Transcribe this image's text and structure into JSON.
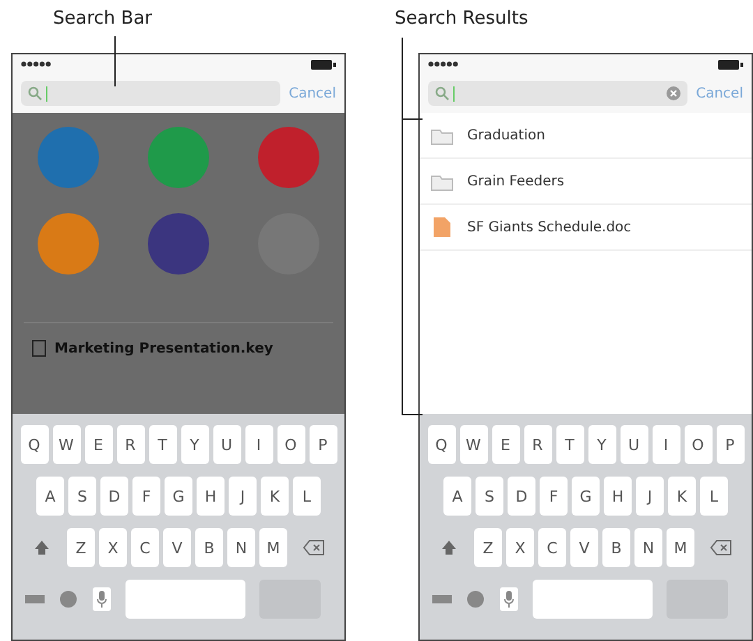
{
  "annotations": [
    {
      "label": "Search Bar"
    },
    {
      "label": "Search Results"
    }
  ],
  "screens": [
    {
      "kind": "browse",
      "search": {
        "cancel": "Cancel",
        "clear_button": false
      },
      "apps": [
        {
          "color": "#1f6fae"
        },
        {
          "color": "#1f9a4a"
        },
        {
          "color": "#c0202c"
        },
        {
          "color": "#d97a16"
        },
        {
          "color": "#3b357f"
        },
        {
          "color": "#777777"
        }
      ],
      "recent": {
        "name": "Marketing Presentation.key"
      },
      "keyboard": {
        "rows": [
          [
            "Q",
            "W",
            "E",
            "R",
            "T",
            "Y",
            "U",
            "I",
            "O",
            "P"
          ],
          [
            "A",
            "S",
            "D",
            "F",
            "G",
            "H",
            "J",
            "K",
            "L"
          ],
          [
            "Z",
            "X",
            "C",
            "V",
            "B",
            "N",
            "M"
          ]
        ]
      }
    },
    {
      "kind": "results",
      "search": {
        "cancel": "Cancel",
        "clear_button": true
      },
      "results": [
        {
          "kind": "folder",
          "name": "Graduation"
        },
        {
          "kind": "folder",
          "name": "Grain Feeders"
        },
        {
          "kind": "document",
          "name": "SF Giants Schedule.doc"
        }
      ],
      "keyboard": {
        "rows": [
          [
            "Q",
            "W",
            "E",
            "R",
            "T",
            "Y",
            "U",
            "I",
            "O",
            "P"
          ],
          [
            "A",
            "S",
            "D",
            "F",
            "G",
            "H",
            "J",
            "K",
            "L"
          ],
          [
            "Z",
            "X",
            "C",
            "V",
            "B",
            "N",
            "M"
          ]
        ]
      }
    }
  ]
}
